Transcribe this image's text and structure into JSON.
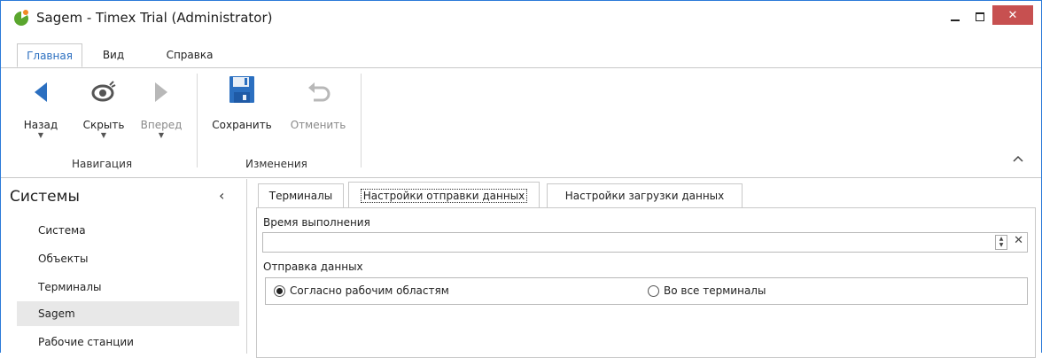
{
  "window": {
    "title": "Sagem - Timex Trial (Administrator)",
    "accent_color": "#2b7bd8",
    "close_color": "#c75050"
  },
  "ribbon_tabs": [
    {
      "label": "Главная",
      "active": true
    },
    {
      "label": "Вид",
      "active": false
    },
    {
      "label": "Справка",
      "active": false
    }
  ],
  "ribbon": {
    "navigation": {
      "group_label": "Навигация",
      "back": {
        "label": "Назад",
        "icon": "arrow-left-icon",
        "enabled": true
      },
      "hide": {
        "label": "Скрыть",
        "icon": "eye-icon",
        "enabled": true
      },
      "forward": {
        "label": "Вперед",
        "icon": "arrow-right-icon",
        "enabled": false
      }
    },
    "changes": {
      "group_label": "Изменения",
      "save": {
        "label": "Сохранить",
        "icon": "floppy-disk-icon",
        "enabled": true
      },
      "undo": {
        "label": "Отменить",
        "icon": "undo-icon",
        "enabled": false
      }
    }
  },
  "left_panel": {
    "title": "Системы",
    "items": [
      {
        "label": "Система",
        "selected": false
      },
      {
        "label": "Объекты",
        "selected": false
      },
      {
        "label": "Терминалы",
        "selected": false
      },
      {
        "label": "Sagem",
        "selected": true
      },
      {
        "label": "Рабочие станции",
        "selected": false
      }
    ]
  },
  "content": {
    "tabs": [
      {
        "label": "Терминалы",
        "active": false
      },
      {
        "label": "Настройки отправки данных",
        "active": true
      },
      {
        "label": "Настройки загрузки данных",
        "active": false
      }
    ],
    "execution_time": {
      "label": "Время выполнения",
      "value": ""
    },
    "send_data": {
      "label": "Отправка данных",
      "options": [
        {
          "label": "Согласно рабочим областям",
          "checked": true
        },
        {
          "label": "Во все терминалы",
          "checked": false
        }
      ]
    }
  }
}
